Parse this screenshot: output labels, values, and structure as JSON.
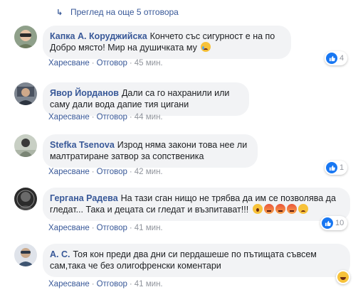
{
  "view_more": {
    "label": "Преглед на още 5 отговора"
  },
  "actions": {
    "like": "Харесване",
    "reply": "Отговор",
    "sep": "·"
  },
  "comments": [
    {
      "author": "Капка А. Коруджийска",
      "text": "Кончето със сигурност е на по Добро място! Мир на душичката му",
      "time": "45 мин.",
      "reaction_type": "like-icon",
      "reaction_count": "4"
    },
    {
      "author": "Явор Йорданов",
      "text": "Дали са го нахранили или саму дали вода дапие тия цигани",
      "time": "44 мин."
    },
    {
      "author": "Stefka Tsenova",
      "text": "Изрод няма закони това нее ли малтратиране затвор за сопственика",
      "time": "42 мин.",
      "reaction_type": "like-icon",
      "reaction_count": "1"
    },
    {
      "author": "Гергана Радева",
      "text": "На тази сган нищо не трябва да им се позволява да гледат... Така и децата си гледат и възпитават!!!",
      "time": "41 мин.",
      "reaction_type": "like-icon",
      "reaction_count": "10"
    },
    {
      "author": "А. С.",
      "text": "Тоя кон преди два дни си пердашеше по пътищата съвсем сам,така че без олигофренски коментари",
      "time": "41 мин.",
      "reaction_type": "haha-icon"
    }
  ],
  "colors": {
    "link": "#385898",
    "bubble": "#f2f3f5",
    "like": "#1877f2",
    "meta": "#90949c"
  }
}
